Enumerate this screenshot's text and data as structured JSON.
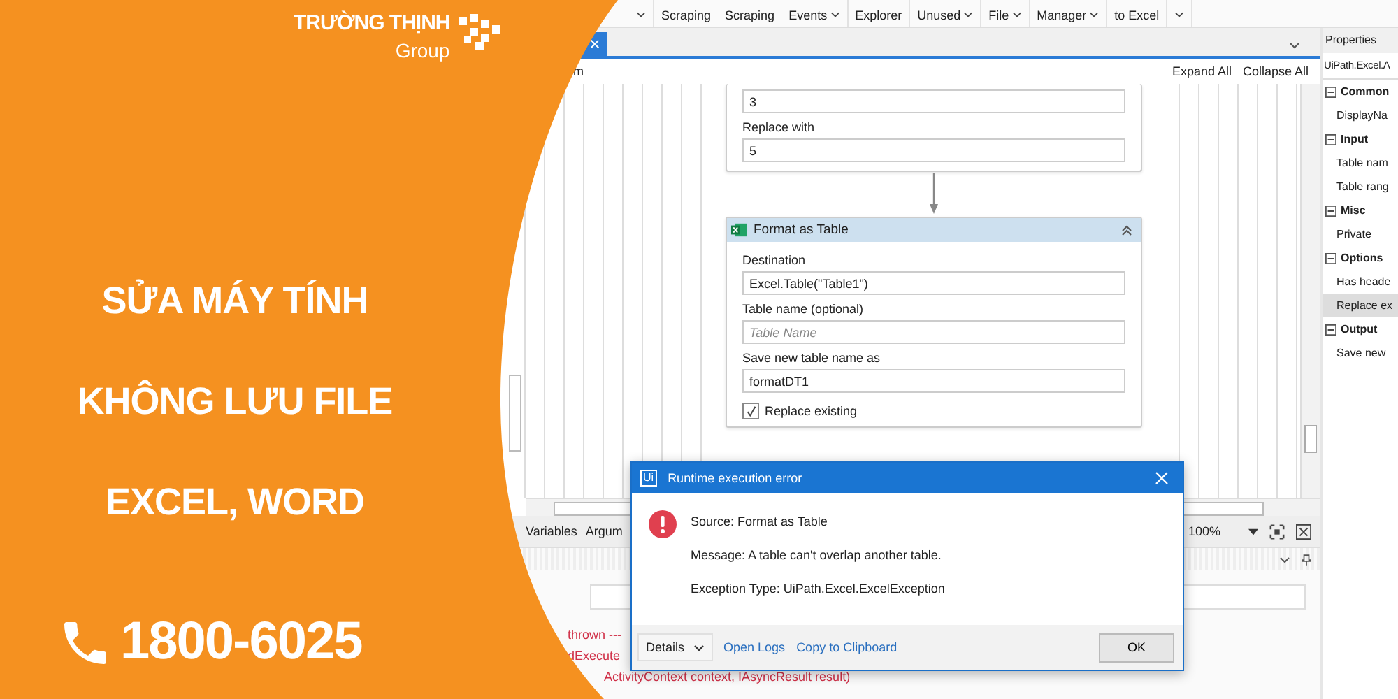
{
  "banner": {
    "logo": {
      "name": "TRƯỜNG THỊNH",
      "sub": "Group"
    },
    "headline": [
      "SỬA MÁY TÍNH",
      "KHÔNG LƯU FILE",
      "EXCEL, WORD"
    ],
    "phone": "1800-6025"
  },
  "ribbon": {
    "items": [
      {
        "dropdown": true
      },
      {
        "label": "Scraping",
        "dropdown": false
      },
      {
        "label": "Scraping",
        "dropdown": false
      },
      {
        "label": "Events",
        "dropdown": true
      },
      {
        "label": "Explorer",
        "dropdown": false
      },
      {
        "label": "Unused",
        "dropdown": true
      },
      {
        "label": "File",
        "dropdown": true
      },
      {
        "label": "Manager",
        "dropdown": true
      },
      {
        "label": "to Excel",
        "dropdown": false
      },
      {
        "dropdown": true
      }
    ]
  },
  "designer": {
    "breadcrumb": "m",
    "actions": [
      "Expand All",
      "Collapse All"
    ],
    "activities": [
      {
        "fields": [
          {
            "kind": "input",
            "value": "3"
          },
          {
            "kind": "label",
            "text": "Replace with"
          },
          {
            "kind": "input",
            "value": "5"
          }
        ]
      },
      {
        "title": "Format as Table",
        "expanded": true,
        "fields": [
          {
            "kind": "label",
            "text": "Destination"
          },
          {
            "kind": "input",
            "value": "Excel.Table(\"Table1\")"
          },
          {
            "kind": "label",
            "text": "Table name (optional)"
          },
          {
            "kind": "input",
            "placeholder": "Table Name"
          },
          {
            "kind": "label",
            "text": "Save new table name as"
          },
          {
            "kind": "input",
            "value": "formatDT1"
          },
          {
            "kind": "checkbox",
            "text": "Replace existing",
            "checked": true
          }
        ]
      }
    ]
  },
  "bottom_tabs": [
    {
      "label": "Variables",
      "selected": false
    },
    {
      "label": "Argum",
      "selected": false
    }
  ],
  "zoom": "100%",
  "output": {
    "lines": [
      "thrown ---",
      "dExecute",
      "ActivityContext context, IAsyncResult result)"
    ]
  },
  "properties": {
    "title": "Properties",
    "type": "UiPath.Excel.A",
    "groups": [
      {
        "name": "Common",
        "expanded": true,
        "items": [
          {
            "label": "DisplayNa",
            "selected": false
          }
        ]
      },
      {
        "name": "Input",
        "expanded": true,
        "items": [
          {
            "label": "Table nam",
            "selected": false
          },
          {
            "label": "Table rang",
            "selected": false
          }
        ]
      },
      {
        "name": "Misc",
        "expanded": true,
        "items": [
          {
            "label": "Private",
            "selected": false
          }
        ]
      },
      {
        "name": "Options",
        "expanded": true,
        "items": [
          {
            "label": "Has heade",
            "selected": false
          },
          {
            "label": "Replace ex",
            "selected": true
          }
        ]
      },
      {
        "name": "Output",
        "expanded": true,
        "items": [
          {
            "label": "Save new",
            "selected": false
          }
        ]
      }
    ]
  },
  "dialog": {
    "app_logo": "Ui",
    "title": "Runtime execution error",
    "lines": [
      "Source: Format as Table",
      "Message: A table can't overlap another table.",
      "Exception Type: UiPath.Excel.ExcelException"
    ],
    "details": "Details",
    "links": [
      "Open Logs",
      "Copy to Clipboard"
    ],
    "ok": "OK"
  }
}
